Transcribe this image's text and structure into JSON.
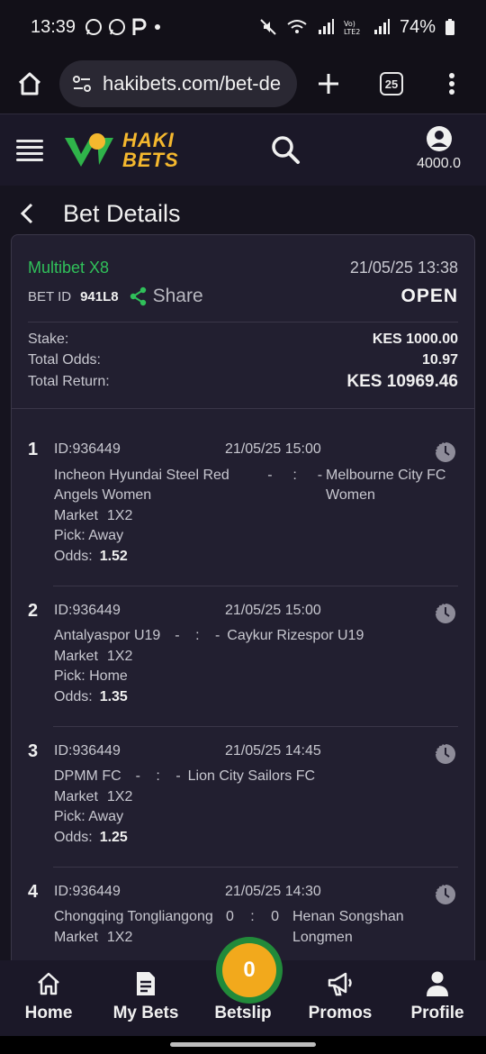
{
  "status_bar": {
    "time": "13:39",
    "battery": "74%"
  },
  "browser": {
    "url": "hakibets.com/bet-de",
    "tab_count": "25"
  },
  "site": {
    "logo_top": "HAKI",
    "logo_bottom": "BETS",
    "balance": "4000.0"
  },
  "page": {
    "title": "Bet Details"
  },
  "bet": {
    "type": "Multibet X8",
    "datetime": "21/05/25 13:38",
    "bet_id_label": "BET ID",
    "bet_id": "941L8",
    "share_label": "Share",
    "status": "OPEN",
    "stake_label": "Stake:",
    "stake": "KES 1000.00",
    "total_odds_label": "Total Odds:",
    "total_odds": "10.97",
    "total_return_label": "Total Return:",
    "total_return": "KES 10969.46"
  },
  "selections": [
    {
      "num": "1",
      "id": "ID:936449",
      "time": "21/05/25 15:00",
      "home": "Incheon Hyundai Steel Red Angels Women",
      "score_home": "-",
      "sep": ":",
      "score_away": "-",
      "away": "Melbourne City FC Women",
      "market_label": "Market",
      "market": "1X2",
      "pick": "Pick: Away",
      "odds_label": "Odds:",
      "odds": "1.52"
    },
    {
      "num": "2",
      "id": "ID:936449",
      "time": "21/05/25 15:00",
      "home": "Antalyaspor U19",
      "score_home": "-",
      "sep": ":",
      "score_away": "-",
      "away": "Caykur Rizespor U19",
      "market_label": "Market",
      "market": "1X2",
      "pick": "Pick: Home",
      "odds_label": "Odds:",
      "odds": "1.35"
    },
    {
      "num": "3",
      "id": "ID:936449",
      "time": "21/05/25 14:45",
      "home": "DPMM FC",
      "score_home": "-",
      "sep": ":",
      "score_away": "-",
      "away": "Lion City Sailors FC",
      "market_label": "Market",
      "market": "1X2",
      "pick": "Pick: Away",
      "odds_label": "Odds:",
      "odds": "1.25"
    },
    {
      "num": "4",
      "id": "ID:936449",
      "time": "21/05/25 14:30",
      "home": "Chongqing Tongliangong",
      "score_home": "0",
      "sep": ":",
      "score_away": "0",
      "away": "Henan Songshan Longmen",
      "market_label": "Market",
      "market": "1X2"
    }
  ],
  "bottom_nav": {
    "home": "Home",
    "my_bets": "My Bets",
    "betslip": "Betslip",
    "betslip_count": "0",
    "promos": "Promos",
    "profile": "Profile"
  },
  "colors": {
    "accent_green": "#30c05a",
    "brand_yellow": "#f5b82e",
    "betslip_orange": "#f2a91c"
  }
}
